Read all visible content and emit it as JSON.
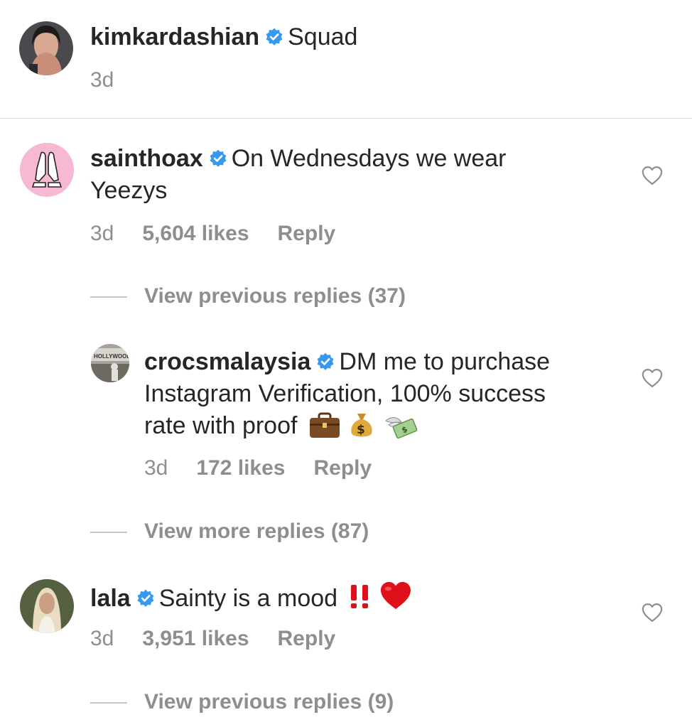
{
  "caption": {
    "username": "kimkardashian",
    "text": "Squad",
    "time": "3d"
  },
  "comments": [
    {
      "username": "sainthoax",
      "text_line1": "On Wednesdays we wear",
      "text_line2": "Yeezys",
      "time": "3d",
      "likes": "5,604 likes",
      "reply": "Reply",
      "view_replies": "View previous replies (37)"
    },
    {
      "username": "crocsmalaysia",
      "text_line1": "DM me to purchase",
      "text_line2": "Instagram Verification, 100% success",
      "text_line3": "rate with proof",
      "time": "3d",
      "likes": "172 likes",
      "reply": "Reply",
      "view_replies": "View more replies (87)"
    },
    {
      "username": "lala",
      "text": "Sainty is a mood",
      "time": "3d",
      "likes": "3,951 likes",
      "reply": "Reply",
      "view_replies": "View previous replies (9)"
    }
  ],
  "colors": {
    "verified_badge": "#3897f0",
    "secondary_text": "#8e8e8e",
    "primary_text": "#262626",
    "avatar_pink": "#f6b8d3",
    "heart_emoji": "#e0101b"
  },
  "icons": [
    "verified-badge-icon",
    "heart-outline-icon",
    "praying-hands-icon",
    "briefcase-emoji",
    "money-bag-emoji",
    "money-wings-emoji",
    "double-exclamation-emoji",
    "red-heart-emoji"
  ]
}
